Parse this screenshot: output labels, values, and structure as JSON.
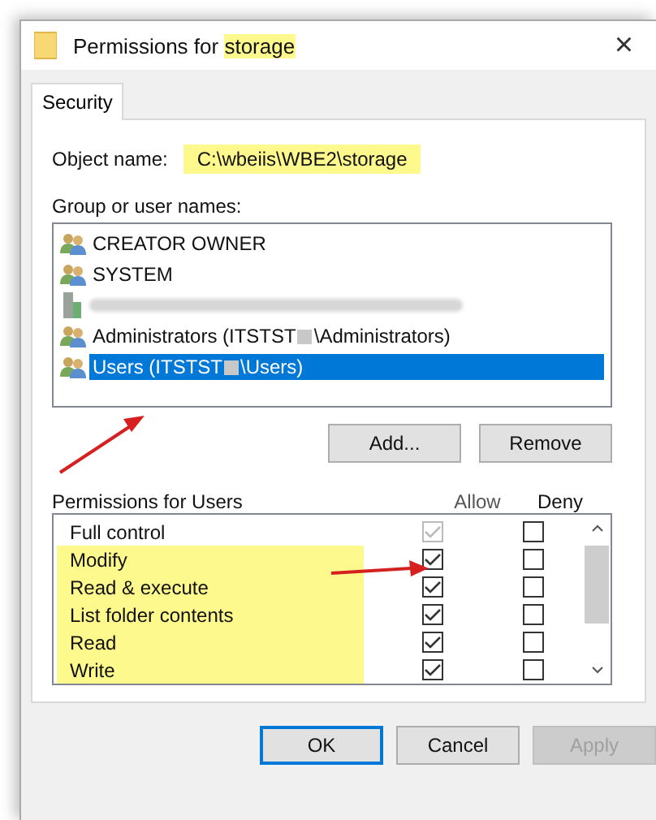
{
  "window": {
    "title_prefix": "Permissions for ",
    "title_object": "storage",
    "title_highlighted": true,
    "close": "×"
  },
  "tabs": [
    {
      "label": "Security",
      "selected": true
    }
  ],
  "object_name": {
    "label": "Object name:",
    "value": "C:\\wbeiis\\WBE2\\storage",
    "highlighted": true
  },
  "group_list": {
    "label": "Group or user names:",
    "items": [
      {
        "kind": "group",
        "before": "CREATOR OWNER",
        "selected": false
      },
      {
        "kind": "group",
        "before": "SYSTEM",
        "selected": false
      },
      {
        "kind": "computer",
        "selected": false,
        "blurred": true
      },
      {
        "kind": "group",
        "before": "Administrators (ITSTST",
        "redacted": true,
        "after": "\\Administrators)",
        "selected": false
      },
      {
        "kind": "group",
        "before": "Users (ITSTST",
        "redacted": true,
        "after": "\\Users)",
        "selected": true
      }
    ]
  },
  "group_buttons": [
    {
      "label": "Add..."
    },
    {
      "label": "Remove"
    }
  ],
  "permissions": {
    "label": "Permissions for Users",
    "allow_header": "Allow",
    "deny_header": "Deny",
    "rows": [
      {
        "name": "Full control",
        "allow": true,
        "allow_disabled": true,
        "deny": false,
        "highlighted": false
      },
      {
        "name": "Modify",
        "allow": true,
        "allow_disabled": false,
        "deny": false,
        "highlighted": true
      },
      {
        "name": "Read & execute",
        "allow": true,
        "allow_disabled": false,
        "deny": false,
        "highlighted": true
      },
      {
        "name": "List folder contents",
        "allow": true,
        "allow_disabled": false,
        "deny": false,
        "highlighted": true
      },
      {
        "name": "Read",
        "allow": true,
        "allow_disabled": false,
        "deny": false,
        "highlighted": true
      },
      {
        "name": "Write",
        "allow": true,
        "allow_disabled": false,
        "deny": false,
        "highlighted": true
      }
    ]
  },
  "dialog_buttons": [
    {
      "label": "OK",
      "default": true,
      "disabled": false
    },
    {
      "label": "Cancel",
      "default": false,
      "disabled": false
    },
    {
      "label": "Apply",
      "default": false,
      "disabled": true
    }
  ]
}
